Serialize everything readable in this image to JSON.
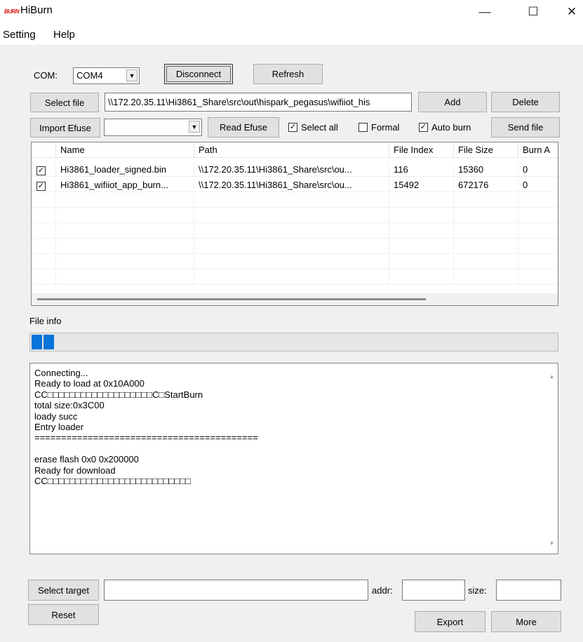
{
  "window": {
    "logo_text": "BURN",
    "title": "HiBurn",
    "min_glyph": "—",
    "max_glyph": "☐",
    "close_glyph": "✕"
  },
  "menu": {
    "setting": "Setting",
    "help": "Help"
  },
  "com": {
    "label": "COM:",
    "value": "COM4",
    "disconnect": "Disconnect",
    "refresh": "Refresh"
  },
  "file_row": {
    "select_file": "Select file",
    "path": "\\\\172.20.35.11\\Hi3861_Share\\src\\out\\hispark_pegasus\\wifiiot_his",
    "add": "Add",
    "delete": "Delete"
  },
  "efuse_row": {
    "import_efuse": "Import Efuse",
    "efuse_value": "",
    "read_efuse": "Read Efuse",
    "select_all": "Select all",
    "select_all_checked": true,
    "formal": "Formal",
    "formal_checked": false,
    "auto_burn": "Auto burn",
    "auto_burn_checked": true,
    "send_file": "Send file"
  },
  "table": {
    "headers": [
      "",
      "Name",
      "Path",
      "File Index",
      "File Size",
      "Burn A"
    ],
    "rows": [
      {
        "checked": true,
        "name": "Hi3861_loader_signed.bin",
        "path": "\\\\172.20.35.11\\Hi3861_Share\\src\\ou...",
        "index": "116",
        "size": "15360",
        "burn": "0"
      },
      {
        "checked": true,
        "name": "Hi3861_wifiiot_app_burn...",
        "path": "\\\\172.20.35.11\\Hi3861_Share\\src\\ou...",
        "index": "15492",
        "size": "672176",
        "burn": "0"
      }
    ]
  },
  "file_info": {
    "label": "File info",
    "progress_chunks": 2
  },
  "log": {
    "text": "Connecting...\nReady to load at 0x10A000\nCC□□□□□□□□□□□□□□□□□□□C□StartBurn\ntotal size:0x3C00\nloady succ\nEntry loader\n==========================================\n\nerase flash 0x0 0x200000\nReady for download\nCC□□□□□□□□□□□□□□□□□□□□□□□□□□"
  },
  "bottom": {
    "select_target": "Select target",
    "target_value": "",
    "addr_label": "addr:",
    "addr_value": "",
    "size_label": "size:",
    "size_value": "",
    "reset": "Reset",
    "export": "Export",
    "more": "More"
  }
}
